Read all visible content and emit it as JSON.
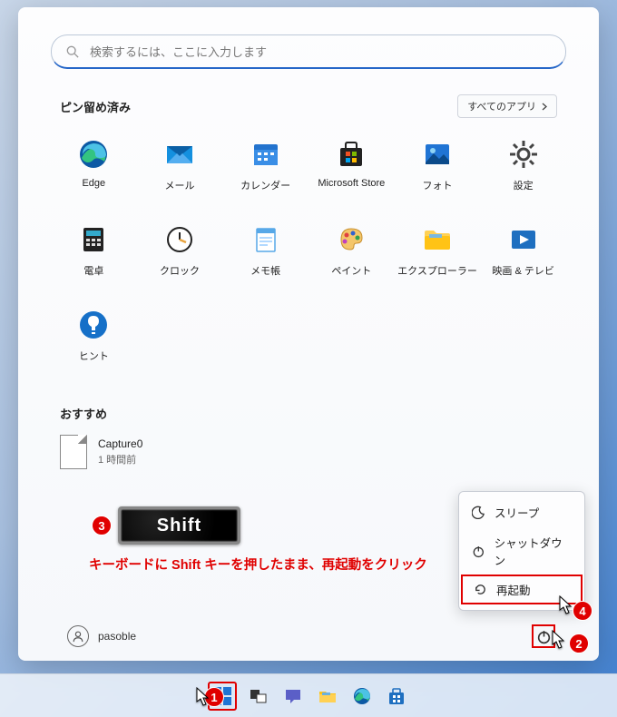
{
  "search": {
    "placeholder": "検索するには、ここに入力します"
  },
  "pinned": {
    "title": "ピン留め済み",
    "all_apps": "すべてのアプリ",
    "apps": [
      {
        "label": "Edge"
      },
      {
        "label": "メール"
      },
      {
        "label": "カレンダー"
      },
      {
        "label": "Microsoft Store"
      },
      {
        "label": "フォト"
      },
      {
        "label": "設定"
      },
      {
        "label": "電卓"
      },
      {
        "label": "クロック"
      },
      {
        "label": "メモ帳"
      },
      {
        "label": "ペイント"
      },
      {
        "label": "エクスプローラー"
      },
      {
        "label": "映画 & テレビ"
      },
      {
        "label": "ヒント"
      }
    ]
  },
  "recommended": {
    "title": "おすすめ",
    "item": {
      "name": "Capture0",
      "time": "1 時間前"
    }
  },
  "shift_key": "Shift",
  "instruction": "キーボードに Shift キーを押したまま、再起動をクリック",
  "user": {
    "name": "pasoble"
  },
  "power_menu": {
    "sleep": "スリープ",
    "shutdown": "シャットダウン",
    "restart": "再起動"
  },
  "annotations": {
    "n1": "1",
    "n2": "2",
    "n3": "3",
    "n4": "4"
  }
}
